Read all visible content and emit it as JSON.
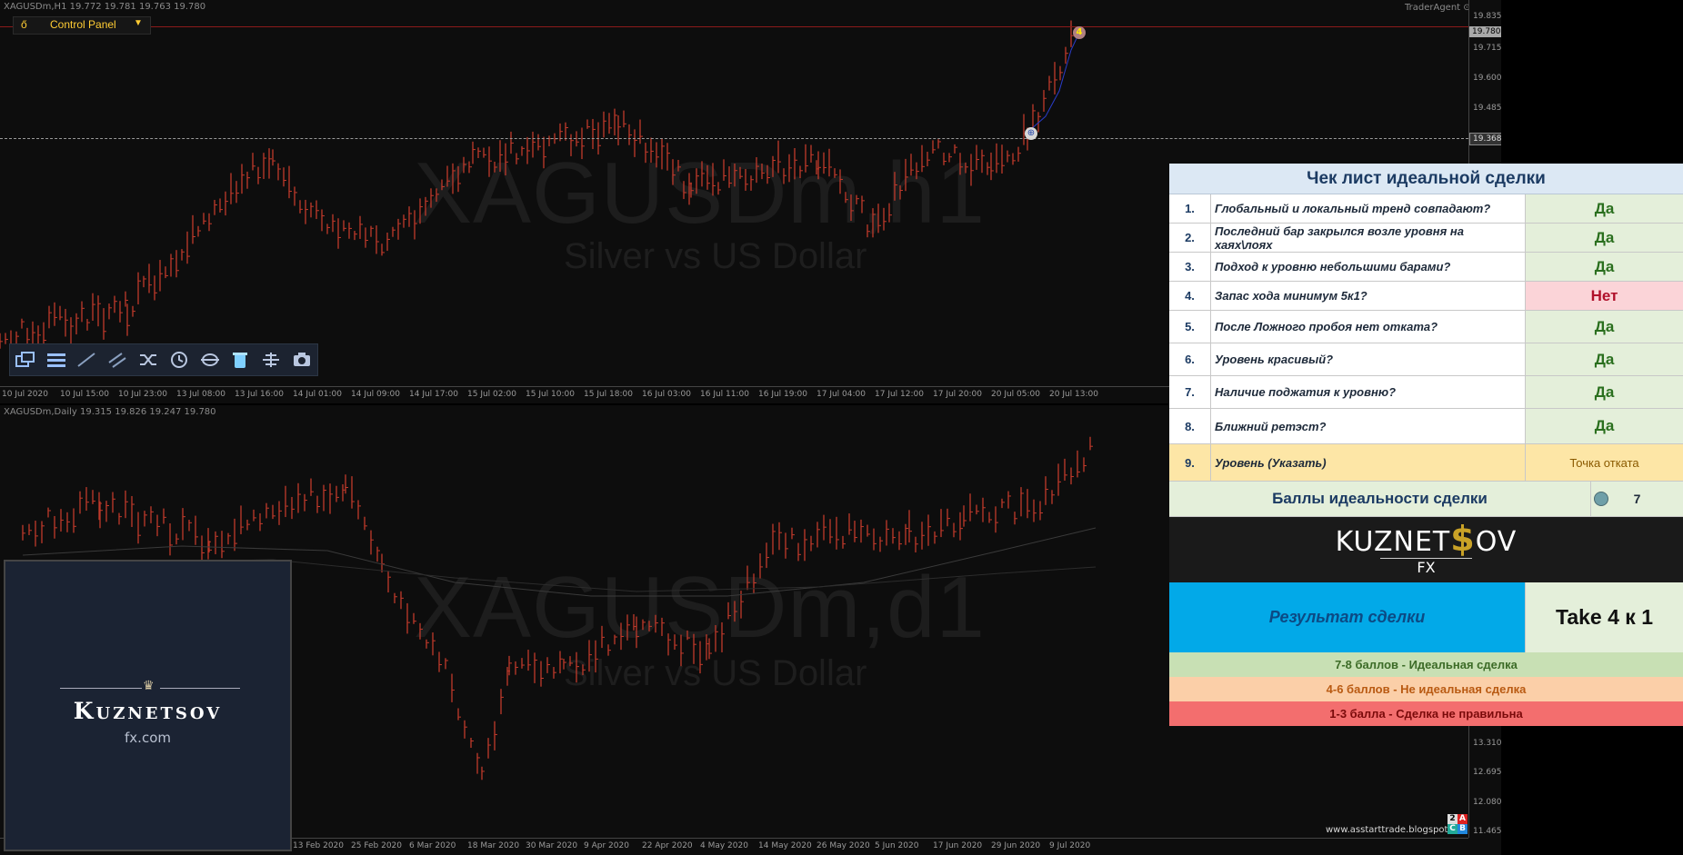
{
  "colors": {
    "bg": "#0d0d0d",
    "candle": "#c0392b",
    "ma": "#3a3a3a",
    "accent": "#ffcc33"
  },
  "top_chart": {
    "info": "XAGUSDm,H1  19.772 19.781 19.763 19.780",
    "watermark_symbol": "XAGUSDm,h1",
    "watermark_desc": "Silver vs US Dollar",
    "agent": "TraderAgent",
    "y_ticks": [
      "19.835",
      "19.715",
      "19.600",
      "19.485"
    ],
    "price_hi": "19.780",
    "price_lo": "19.368",
    "x_ticks": [
      "10 Jul 2020",
      "10 Jul 15:00",
      "10 Jul 23:00",
      "13 Jul 08:00",
      "13 Jul 16:00",
      "14 Jul 01:00",
      "14 Jul 09:00",
      "14 Jul 17:00",
      "15 Jul 02:00",
      "15 Jul 10:00",
      "15 Jul 18:00",
      "16 Jul 03:00",
      "16 Jul 11:00",
      "16 Jul 19:00",
      "17 Jul 04:00",
      "17 Jul 12:00",
      "17 Jul 20:00",
      "20 Jul 05:00",
      "20 Jul 13:00"
    ],
    "marker_top": "4"
  },
  "bottom_chart": {
    "info": "XAGUSDm,Daily  19.315 19.826 19.247 19.780",
    "watermark_symbol": "XAGUSDm,d1",
    "watermark_desc": "Silver vs US Dollar",
    "y_ticks": [
      "13.310",
      "12.695",
      "12.080",
      "11.465"
    ],
    "x_ticks": [
      "13 Feb 2020",
      "25 Feb 2020",
      "6 Mar 2020",
      "18 Mar 2020",
      "30 Mar 2020",
      "9 Apr 2020",
      "22 Apr 2020",
      "4 May 2020",
      "14 May 2020",
      "26 May 2020",
      "5 Jun 2020",
      "17 Jun 2020",
      "29 Jun 2020",
      "9 Jul 2020"
    ],
    "site": "www.asstarttrade.blogspot",
    "badges": [
      "2",
      "A",
      "C",
      "B"
    ]
  },
  "control_panel": {
    "icon": "ő",
    "label": "Control Panel"
  },
  "toolbar": {
    "icons": [
      "windows-icon",
      "menu-icon",
      "trendline-icon",
      "channel-icon",
      "shuffle-icon",
      "clock-icon",
      "sync-icon",
      "trash-icon",
      "level-icon",
      "camera-icon"
    ]
  },
  "logo_box": {
    "name": "Kuznetsov",
    "domain": "fx.com"
  },
  "checklist": {
    "title": "Чек лист идеальной сделки",
    "rows": [
      {
        "num": "1.",
        "q": "Глобальный и локальный тренд совпадают?",
        "a": "Да"
      },
      {
        "num": "2.",
        "q": "Последний бар закрылся возле уровня на хаях\\лоях",
        "a": "Да"
      },
      {
        "num": "3.",
        "q": "Подход к уровню небольшими барами?",
        "a": "Да"
      },
      {
        "num": "4.",
        "q": "Запас хода минимум 5к1?",
        "a": "Нет"
      },
      {
        "num": "5.",
        "q": "После Ложного пробоя нет отката?",
        "a": "Да"
      },
      {
        "num": "6.",
        "q": "Уровень красивый?",
        "a": "Да"
      },
      {
        "num": "7.",
        "q": "Наличие поджатия к уровню?",
        "a": "Да"
      },
      {
        "num": "8.",
        "q": "Ближний ретэст?",
        "a": "Да"
      },
      {
        "num": "9.",
        "q": "Уровень (Указать)",
        "a": "Точка отката"
      }
    ],
    "score_label": "Баллы идеальности сделки",
    "score_value": "7",
    "brand_main_left": "KUZNET",
    "brand_dollar": "$",
    "brand_main_right": "OV",
    "brand_sub": "FX",
    "result_label": "Результат сделки",
    "result_value": "Take 4 к 1",
    "legend": [
      "7-8 баллов - Идеальная сделка",
      "4-6 баллов - Не идеальная сделка",
      "1-3 балла - Сделка не правильна"
    ]
  }
}
